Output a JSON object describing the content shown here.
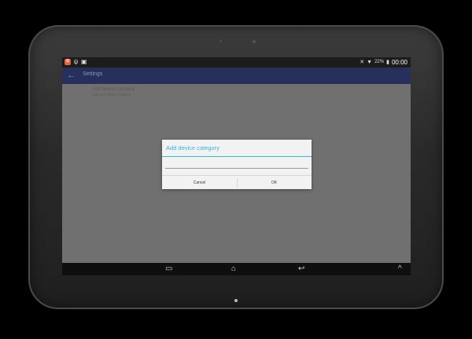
{
  "statusbar": {
    "notifications": [
      {
        "icon": "app-notification-icon",
        "glyph": "⛨"
      },
      {
        "icon": "usb-icon",
        "glyph": "ψ"
      },
      {
        "icon": "image-icon",
        "glyph": "▣"
      }
    ],
    "battery_percent": "22%",
    "clock": "00:00"
  },
  "actionbar": {
    "title": "Settings"
  },
  "list": {
    "items": [
      {
        "title": "Add device category",
        "subtitle": "Add new device category"
      }
    ]
  },
  "dialog": {
    "title": "Add device category",
    "input_value": "",
    "cancel_label": "Cancel",
    "ok_label": "OK"
  },
  "colors": {
    "accent": "#33b5e5",
    "actionbar": "#27305a"
  }
}
